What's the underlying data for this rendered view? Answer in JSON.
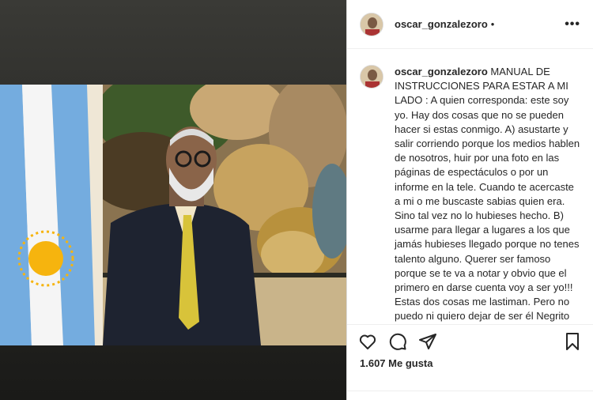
{
  "post": {
    "username": "oscar_gonzalezoro",
    "separator": "•",
    "more_label": "•••",
    "caption": "MANUAL DE INSTRUCCIONES PARA ESTAR A MI LADO : A quien corresponda: este soy yo. Hay dos cosas que no se pueden hacer si estas conmigo. A) asustarte y salir corriendo porque los medios hablen de nosotros, huir por una foto en las páginas de espectáculos o por un informe en la tele. Cuando te acercaste a mi o me buscaste sabias quien era. Sino tal vez no lo hubieses hecho. B) usarme para llegar a lugares a los que jamás hubieses llegado porque no tenes talento alguno. Querer ser famoso porque se te va a notar y obvio que el primero en darse cuenta voy a ser yo!!! Estas dos cosas me lastiman. Pero no puedo ni quiero dejar de ser él Negrito Oro. Quiero ser",
    "likes": "1.607 Me gusta"
  },
  "icons": {
    "like": "heart-icon",
    "comment": "comment-icon",
    "share": "share-icon",
    "save": "bookmark-icon",
    "more": "more-icon"
  },
  "colors": {
    "text": "#262626",
    "border": "#dbdbdb",
    "panel_dark": "#2b2b28",
    "flag_blue": "#74acdf",
    "sun": "#f6b40e"
  }
}
